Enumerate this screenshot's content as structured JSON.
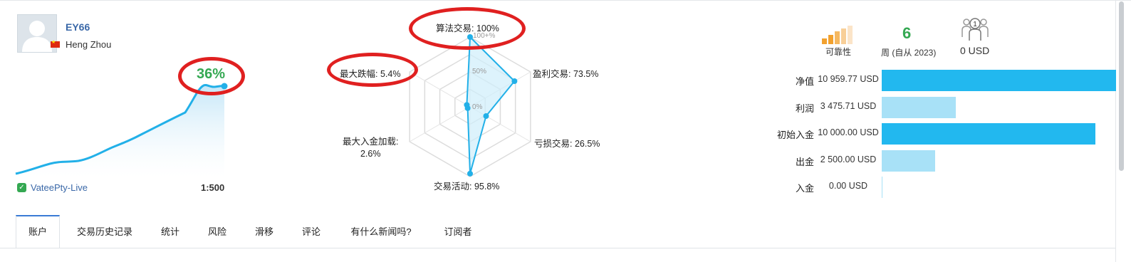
{
  "profile": {
    "username": "EY66",
    "location": "Heng Zhou",
    "growth": "36%",
    "server": "VateePty-Live",
    "leverage": "1:500"
  },
  "radar": {
    "tick_100": "100+%",
    "tick_50": "50%",
    "tick_0": "0%",
    "axes": [
      {
        "label": "算法交易: 100%",
        "value": 100
      },
      {
        "label": "盈利交易: 73.5%",
        "value": 73.5
      },
      {
        "label": "亏损交易: 26.5%",
        "value": 26.5
      },
      {
        "label": "交易活动: 95.8%",
        "value": 95.8
      },
      {
        "label_line1": "最大入金加载:",
        "label_line2": "2.6%",
        "value": 2.6
      },
      {
        "label": "最大跌幅: 5.4%",
        "value": 5.4
      }
    ]
  },
  "reliability": {
    "label": "可靠性"
  },
  "weeks": {
    "value": "6",
    "label": "周 (自从 2023)"
  },
  "subscribers": {
    "count": "1",
    "value": "0 USD"
  },
  "stats": [
    {
      "name": "净值",
      "value": "10 959.77 USD",
      "amount": 10959.77,
      "color": "#22b8ef"
    },
    {
      "name": "利润",
      "value": "3 475.71 USD",
      "amount": 3475.71,
      "color": "#a8e1f7"
    },
    {
      "name": "初始入金",
      "value": "10 000.00 USD",
      "amount": 10000.0,
      "color": "#22b8ef"
    },
    {
      "name": "出金",
      "value": "2 500.00 USD",
      "amount": 2500.0,
      "color": "#a8e1f7"
    },
    {
      "name": "入金",
      "value": "0.00 USD",
      "amount": 0.0,
      "color": "#a8e1f7"
    }
  ],
  "tabs": [
    "账户",
    "交易历史记录",
    "统计",
    "风险",
    "滑移",
    "评论",
    "有什么新闻吗?",
    "订阅者"
  ],
  "colors": {
    "accent": "#22b8ef",
    "growth": "#34a852",
    "highlight": "#e02020",
    "link": "#3a68a8"
  }
}
